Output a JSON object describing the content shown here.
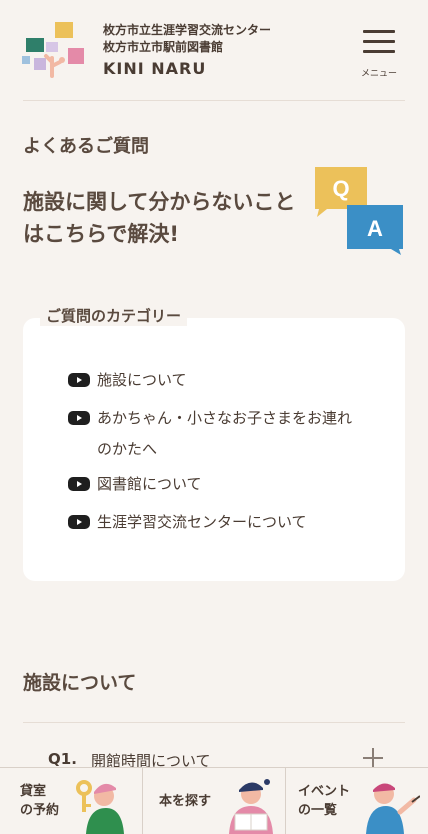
{
  "header": {
    "org_line1": "枚方市立生涯学習交流センター",
    "org_line2": "枚方市立市駅前図書館",
    "brand": "KINI NARU",
    "menu_label": "メニュー",
    "logo_icon": "kininaru-logo-icon",
    "menu_icon": "hamburger-icon"
  },
  "faq": {
    "heading": "よくあるご質問",
    "lead_line1": "施設に関して分からないこと",
    "lead_line2": "はこちらで解決!",
    "qa_icon": "qa-speech-bubbles-icon"
  },
  "categories": {
    "title": "ご質問のカテゴリー",
    "items": [
      {
        "line1": "施設について",
        "line2": ""
      },
      {
        "line1": "あかちゃん・小さなお子さまをお連れ",
        "line2": "のかたへ"
      },
      {
        "line1": "図書館について",
        "line2": ""
      },
      {
        "line1": "生涯学習交流センターについて",
        "line2": ""
      }
    ]
  },
  "section": {
    "heading": "施設について",
    "questions": [
      {
        "num": "Q1.",
        "text": "開館時間について"
      }
    ]
  },
  "bottom_nav": {
    "items": [
      {
        "line1": "貸室",
        "line2": "の予約"
      },
      {
        "line1": "本を探す",
        "line2": ""
      },
      {
        "line1": "イベント",
        "line2": "の一覧"
      }
    ]
  },
  "colors": {
    "background": "#f7f3ef",
    "text": "#5a4a3f",
    "card": "#ffffff",
    "qa_yellow": "#ecc15a",
    "qa_blue": "#3b8fc6"
  }
}
